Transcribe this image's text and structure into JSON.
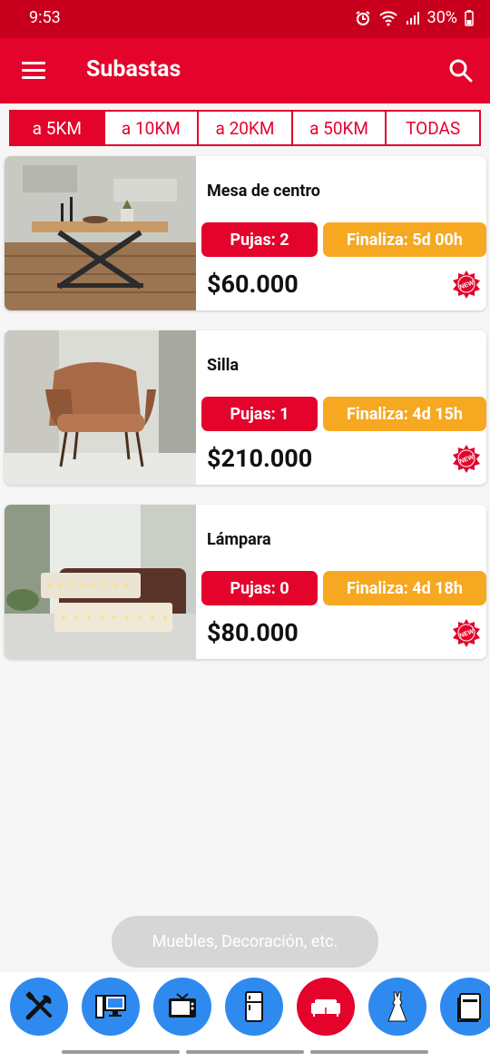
{
  "status": {
    "time": "9:53",
    "battery": "30%"
  },
  "appbar": {
    "title": "Subastas"
  },
  "tabs": [
    {
      "label": "a 5KM",
      "active": true
    },
    {
      "label": "a 10KM"
    },
    {
      "label": "a 20KM"
    },
    {
      "label": "a 50KM"
    },
    {
      "label": "TODAS"
    }
  ],
  "items": [
    {
      "name": "Mesa de centro",
      "bids": "Pujas: 2",
      "ends": "Finaliza: 5d 00h",
      "price": "$60.000",
      "badge": "NEW"
    },
    {
      "name": "Silla",
      "bids": "Pujas: 1",
      "ends": "Finaliza: 4d 15h",
      "price": "$210.000",
      "badge": "NEW"
    },
    {
      "name": "Lámpara",
      "bids": "Pujas: 0",
      "ends": "Finaliza: 4d 18h",
      "price": "$80.000",
      "badge": "NEW"
    }
  ],
  "toast": "Muebles, Decoración, etc.",
  "categories": [
    {
      "icon": "tools-icon"
    },
    {
      "icon": "computer-icon"
    },
    {
      "icon": "tv-icon"
    },
    {
      "icon": "fridge-icon"
    },
    {
      "icon": "sofa-icon",
      "active": true
    },
    {
      "icon": "dress-icon"
    },
    {
      "icon": "book-icon"
    }
  ],
  "colors": {
    "primary": "#e3032b",
    "statusbar": "#c8001e",
    "accent": "#f6a821",
    "category": "#2f8af0"
  }
}
